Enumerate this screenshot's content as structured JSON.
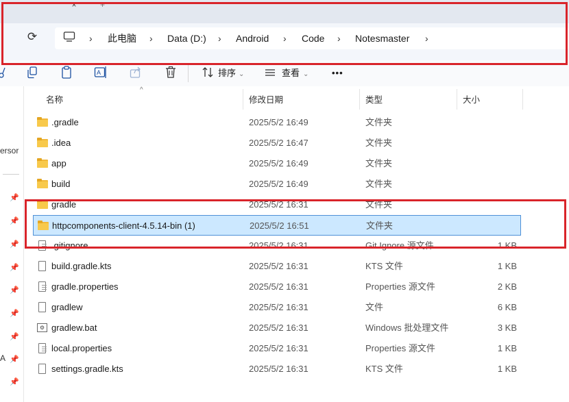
{
  "tabs": {
    "close_glyph": "×",
    "new_glyph": "+"
  },
  "address": {
    "crumbs": [
      "此电脑",
      "Data (D:)",
      "Android",
      "Code",
      "Notesmaster"
    ],
    "separator": "›"
  },
  "toolbar": {
    "sort_label": "排序",
    "view_label": "查看",
    "more_label": "•••"
  },
  "nav": {
    "person_text": "ersor",
    "a_text": "A"
  },
  "columns": {
    "name": "名称",
    "date": "修改日期",
    "type": "类型",
    "size": "大小"
  },
  "files": [
    {
      "name": ".gradle",
      "date": "2025/5/2 16:49",
      "type": "文件夹",
      "size": "",
      "icon": "folder-icon"
    },
    {
      "name": ".idea",
      "date": "2025/5/2 16:47",
      "type": "文件夹",
      "size": "",
      "icon": "folder-icon"
    },
    {
      "name": "app",
      "date": "2025/5/2 16:49",
      "type": "文件夹",
      "size": "",
      "icon": "folder-icon"
    },
    {
      "name": "build",
      "date": "2025/5/2 16:49",
      "type": "文件夹",
      "size": "",
      "icon": "folder-icon"
    },
    {
      "name": "gradle",
      "date": "2025/5/2 16:31",
      "type": "文件夹",
      "size": "",
      "icon": "folder-icon"
    },
    {
      "name": "httpcomponents-client-4.5.14-bin (1)",
      "date": "2025/5/2 16:51",
      "type": "文件夹",
      "size": "",
      "icon": "folder-icon",
      "selected": true
    },
    {
      "name": ".gitignore",
      "date": "2025/5/2 16:31",
      "type": "Git Ignore 源文件",
      "size": "1 KB",
      "icon": "gitignore-file-icon"
    },
    {
      "name": "build.gradle.kts",
      "date": "2025/5/2 16:31",
      "type": "KTS 文件",
      "size": "1 KB",
      "icon": "file-icon"
    },
    {
      "name": "gradle.properties",
      "date": "2025/5/2 16:31",
      "type": "Properties 源文件",
      "size": "2 KB",
      "icon": "text-file-icon"
    },
    {
      "name": "gradlew",
      "date": "2025/5/2 16:31",
      "type": "文件",
      "size": "6 KB",
      "icon": "file-icon"
    },
    {
      "name": "gradlew.bat",
      "date": "2025/5/2 16:31",
      "type": "Windows 批处理文件",
      "size": "3 KB",
      "icon": "batch-file-icon"
    },
    {
      "name": "local.properties",
      "date": "2025/5/2 16:31",
      "type": "Properties 源文件",
      "size": "1 KB",
      "icon": "text-file-icon"
    },
    {
      "name": "settings.gradle.kts",
      "date": "2025/5/2 16:31",
      "type": "KTS 文件",
      "size": "1 KB",
      "icon": "file-icon"
    }
  ],
  "colors": {
    "selection": "#cce8ff",
    "annotation": "#d9242a",
    "folder": "#f8c94b"
  }
}
